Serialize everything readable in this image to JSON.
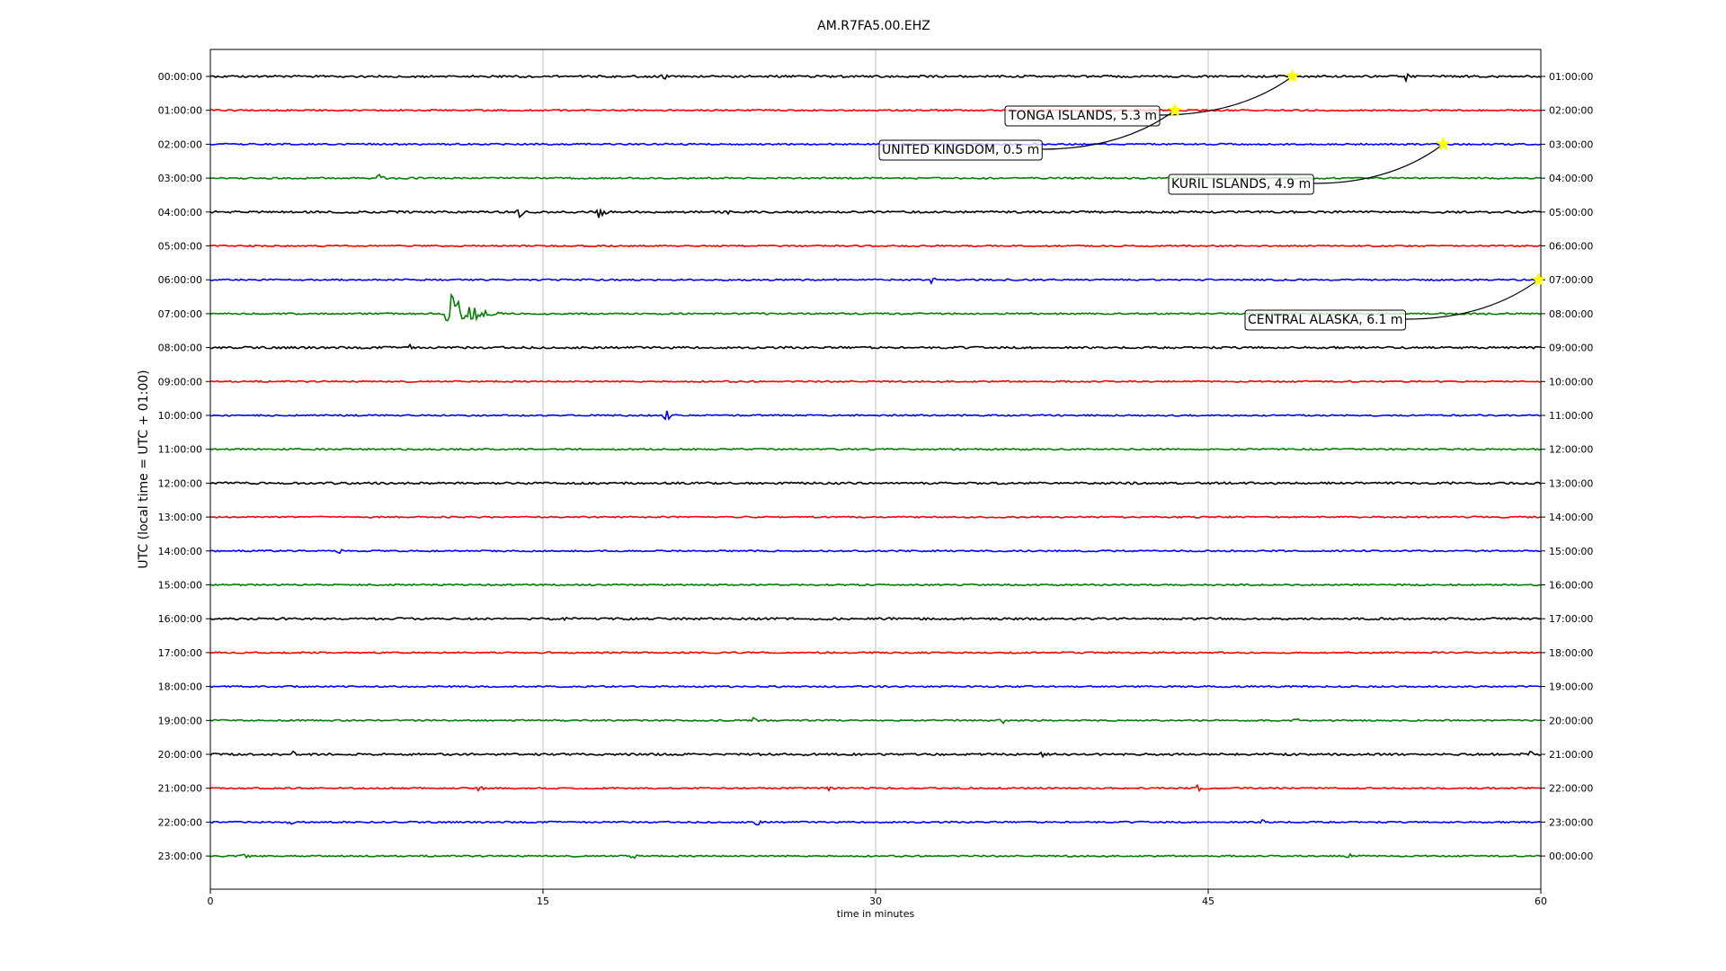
{
  "chart_data": {
    "type": "line",
    "title": "AM.R7FA5.00.EHZ",
    "xlabel": "time in minutes",
    "ylabel": "UTC (local time = UTC + 01:00)",
    "xlim": [
      0,
      60
    ],
    "xticks": [
      "0",
      "15",
      "30",
      "45",
      "60"
    ],
    "x_gridlines": [
      15,
      30,
      45
    ],
    "grid": "vertical",
    "left_tick_labels": [
      "00:00:00",
      "01:00:00",
      "02:00:00",
      "03:00:00",
      "04:00:00",
      "05:00:00",
      "06:00:00",
      "07:00:00",
      "08:00:00",
      "09:00:00",
      "10:00:00",
      "11:00:00",
      "12:00:00",
      "13:00:00",
      "14:00:00",
      "15:00:00",
      "16:00:00",
      "17:00:00",
      "18:00:00",
      "19:00:00",
      "20:00:00",
      "21:00:00",
      "22:00:00",
      "23:00:00"
    ],
    "right_tick_labels": [
      "01:00:00",
      "02:00:00",
      "03:00:00",
      "04:00:00",
      "05:00:00",
      "06:00:00",
      "07:00:00",
      "08:00:00",
      "09:00:00",
      "10:00:00",
      "11:00:00",
      "12:00:00",
      "13:00:00",
      "14:00:00",
      "15:00:00",
      "16:00:00",
      "17:00:00",
      "18:00:00",
      "19:00:00",
      "20:00:00",
      "21:00:00",
      "22:00:00",
      "23:00:00",
      "00:00:00"
    ],
    "trace_colors": [
      "#000000",
      "#ff0000",
      "#0000ff",
      "#008000"
    ],
    "events": [
      {
        "label": "TONGA ISLANDS, 5.3 m",
        "hour": 0,
        "minute": 48.8
      },
      {
        "label": "UNITED KINGDOM, 0.5 m",
        "hour": 1,
        "minute": 43.5
      },
      {
        "label": "KURIL ISLANDS, 4.9 m",
        "hour": 2,
        "minute": 55.6
      },
      {
        "label": "CENTRAL ALASKA, 6.1 m",
        "hour": 6,
        "minute": 59.9
      }
    ],
    "event_marker_color": "#ffff00",
    "bursts": [
      {
        "hour": 0,
        "minute": 20.4,
        "amp": 0.35
      },
      {
        "hour": 0,
        "minute": 53.9,
        "amp": 0.3
      },
      {
        "hour": 3,
        "minute": 7.6,
        "amp": 0.4
      },
      {
        "hour": 4,
        "minute": 13.9,
        "amp": 0.5
      },
      {
        "hour": 4,
        "minute": 17.5,
        "amp": 0.65
      },
      {
        "hour": 4,
        "minute": 23.4,
        "amp": 0.25
      },
      {
        "hour": 6,
        "minute": 32.5,
        "amp": 0.25
      },
      {
        "hour": 7,
        "minute": 10.7,
        "amp": 2.0
      },
      {
        "hour": 8,
        "minute": 9.0,
        "amp": 0.3
      },
      {
        "hour": 10,
        "minute": 20.5,
        "amp": 0.6
      },
      {
        "hour": 14,
        "minute": 5.8,
        "amp": 0.25
      },
      {
        "hour": 16,
        "minute": 15.8,
        "amp": 0.3
      },
      {
        "hour": 19,
        "minute": 24.5,
        "amp": 0.3
      },
      {
        "hour": 19,
        "minute": 35.6,
        "amp": 0.45
      },
      {
        "hour": 19,
        "minute": 48.8,
        "amp": 0.35
      },
      {
        "hour": 20,
        "minute": 3.6,
        "amp": 0.35
      },
      {
        "hour": 20,
        "minute": 26.8,
        "amp": 0.3
      },
      {
        "hour": 20,
        "minute": 37.5,
        "amp": 0.25
      },
      {
        "hour": 20,
        "minute": 59.5,
        "amp": 0.3
      },
      {
        "hour": 21,
        "minute": 12.1,
        "amp": 0.3
      },
      {
        "hour": 21,
        "minute": 27.8,
        "amp": 0.3
      },
      {
        "hour": 21,
        "minute": 44.5,
        "amp": 0.3
      },
      {
        "hour": 22,
        "minute": 3.5,
        "amp": 0.3
      },
      {
        "hour": 22,
        "minute": 24.6,
        "amp": 0.3
      },
      {
        "hour": 22,
        "minute": 47.4,
        "amp": 0.3
      },
      {
        "hour": 23,
        "minute": 1.5,
        "amp": 0.3
      },
      {
        "hour": 23,
        "minute": 19.0,
        "amp": 0.3
      },
      {
        "hour": 23,
        "minute": 51.2,
        "amp": 0.35
      }
    ]
  }
}
